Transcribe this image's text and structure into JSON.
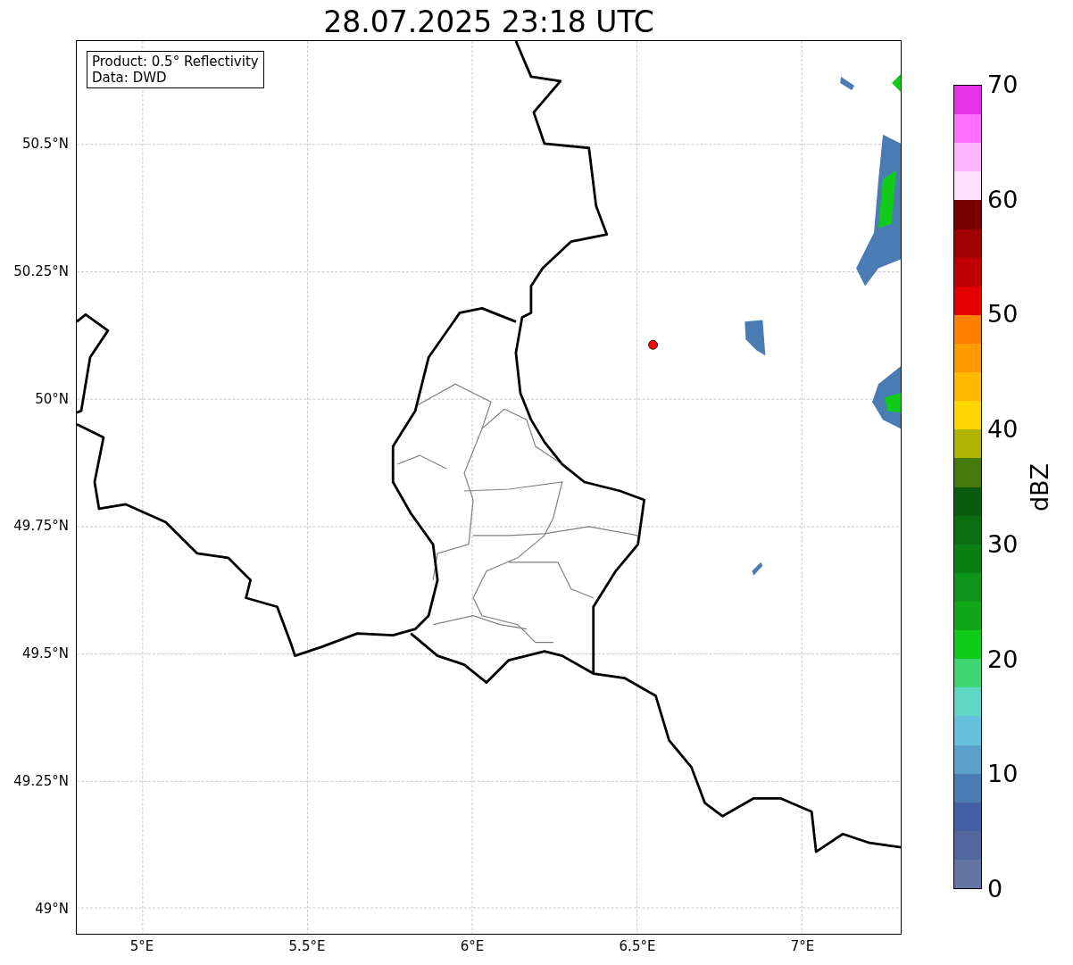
{
  "title": "28.07.2025 23:18 UTC",
  "legend": [
    "Product: 0.5° Reflectivity",
    "Data: DWD"
  ],
  "x_ticks": [
    "5°E",
    "5.5°E",
    "6°E",
    "6.5°E",
    "7°E"
  ],
  "y_ticks": [
    "50.5°N",
    "50.25°N",
    "50°N",
    "49.75°N",
    "49.5°N",
    "49.25°N",
    "49°N"
  ],
  "colorbar": {
    "label": "dBZ",
    "ticks": [
      "70",
      "60",
      "50",
      "40",
      "30",
      "20",
      "10",
      "0"
    ],
    "segments": [
      {
        "color": "#e632e6"
      },
      {
        "color": "#ff6eff"
      },
      {
        "color": "#ffb4ff"
      },
      {
        "color": "#ffe0ff"
      },
      {
        "color": "#7a0000"
      },
      {
        "color": "#a00000"
      },
      {
        "color": "#c00000"
      },
      {
        "color": "#e40000"
      },
      {
        "color": "#ff7f00"
      },
      {
        "color": "#ff9a00"
      },
      {
        "color": "#ffb800"
      },
      {
        "color": "#ffd600"
      },
      {
        "color": "#b0b404"
      },
      {
        "color": "#467a0a"
      },
      {
        "color": "#085c0c"
      },
      {
        "color": "#0a6e10"
      },
      {
        "color": "#0a8012"
      },
      {
        "color": "#0e9418"
      },
      {
        "color": "#10a818"
      },
      {
        "color": "#10cc18"
      },
      {
        "color": "#3dd672"
      },
      {
        "color": "#5fd6c3"
      },
      {
        "color": "#66c2dc"
      },
      {
        "color": "#5aa0c8"
      },
      {
        "color": "#4a7cb3"
      },
      {
        "color": "#445fa3"
      },
      {
        "color": "#5468a0"
      },
      {
        "color": "#6475a5"
      }
    ]
  }
}
